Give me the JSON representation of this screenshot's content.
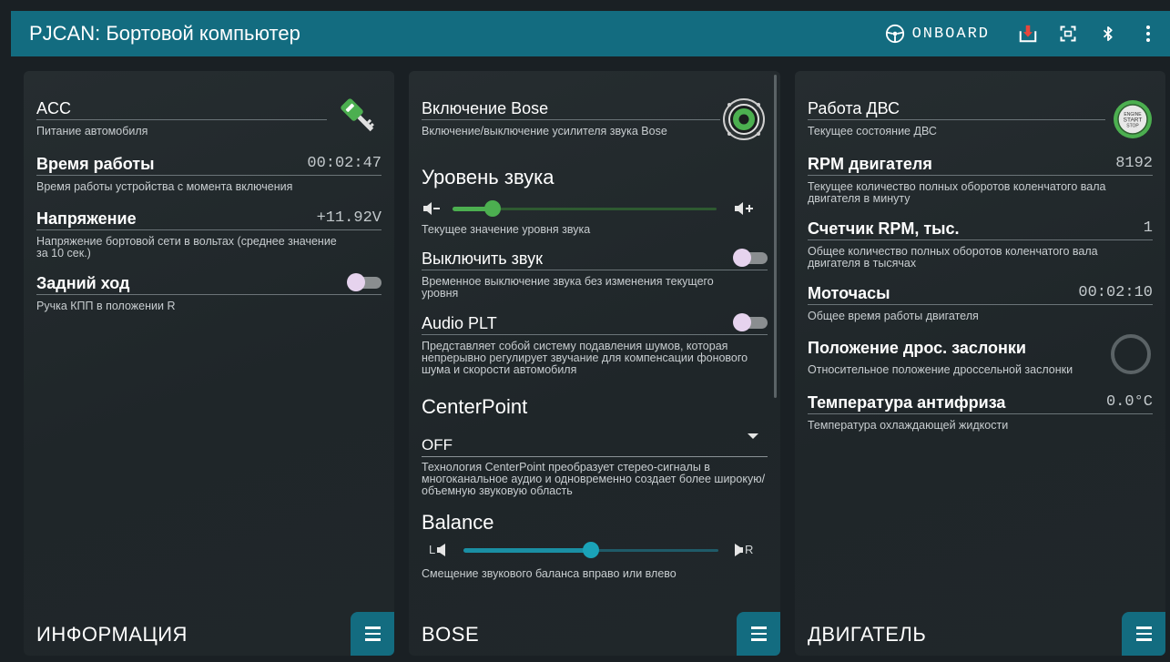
{
  "app": {
    "title": "PJCAN: Бортовой компьютер"
  },
  "topbar": {
    "onboard_label": "ONBOARD"
  },
  "info": {
    "footer": "ИНФОРМАЦИЯ",
    "acc": {
      "title": "ACC",
      "desc": "Питание автомобиля"
    },
    "worktime": {
      "title": "Время работы",
      "value": "00:02:47",
      "desc": "Время работы устройства с момента включения"
    },
    "voltage": {
      "title": "Напряжение",
      "value": "+11.92V",
      "desc": "Напряжение бортовой сети в вольтах (среднее значение за 10 сек.)"
    },
    "reverse": {
      "title": "Задний ход",
      "desc": "Ручка КПП в положении R"
    }
  },
  "bose": {
    "footer": "BOSE",
    "enable": {
      "title": "Включение Bose",
      "desc": "Включение/выключение усилителя звука Bose"
    },
    "volume": {
      "title": "Уровень звука",
      "desc": "Текущее значение уровня звука",
      "level": 0.15
    },
    "mute": {
      "title": "Выключить звук",
      "desc": "Временное выключение звука без изменения текущего уровня"
    },
    "audioplt": {
      "title": "Audio PLT",
      "desc": "Представляет собой систему подавления шумов, которая непрерывно регулирует звучание для компенсации фонового шума и скорости автомобиля"
    },
    "centerpoint": {
      "title": "CenterPoint",
      "value": "OFF",
      "desc": "Технология CenterPoint преобразует стерео-сигналы в многоканальное аудио и одновременно создает более широкую/объемную звуковую область"
    },
    "balance": {
      "title": "Balance",
      "left": "L",
      "right": "R",
      "desc": "Смещение звукового баланса вправо или влево",
      "level": 0.5
    }
  },
  "engine": {
    "footer": "ДВИГАТЕЛЬ",
    "running": {
      "title": "Работа ДВС",
      "desc": "Текущее состояние ДВС"
    },
    "rpm": {
      "title": "RPM двигателя",
      "value": "8192",
      "desc": "Текущее количество полных оборотов коленчатого вала двигателя в минуту"
    },
    "rpmcount": {
      "title": "Счетчик RPM, тыс.",
      "value": "1",
      "desc": "Общее количество полных оборотов коленчатого вала двигателя в тысячах"
    },
    "motohours": {
      "title": "Моточасы",
      "value": "00:02:10",
      "desc": "Общее время работы двигателя"
    },
    "throttle": {
      "title": "Положение дрос. заслонки",
      "desc": "Относительное положение дроссельной заслонки"
    },
    "coolant": {
      "title": "Температура антифриза",
      "value": "0.0°C",
      "desc": "Температура охлаждающей жидкости"
    }
  },
  "colors": {
    "accent": "#136c80",
    "green": "#4caf50",
    "teal": "#1aa3b8"
  },
  "icons": [
    "steering-wheel-icon",
    "download-icon",
    "fullscreen-icon",
    "bluetooth-icon",
    "more-vert-icon",
    "key-icon",
    "speaker-icon",
    "engine-start-icon",
    "volume-down-icon",
    "volume-up-icon",
    "menu-icon"
  ]
}
